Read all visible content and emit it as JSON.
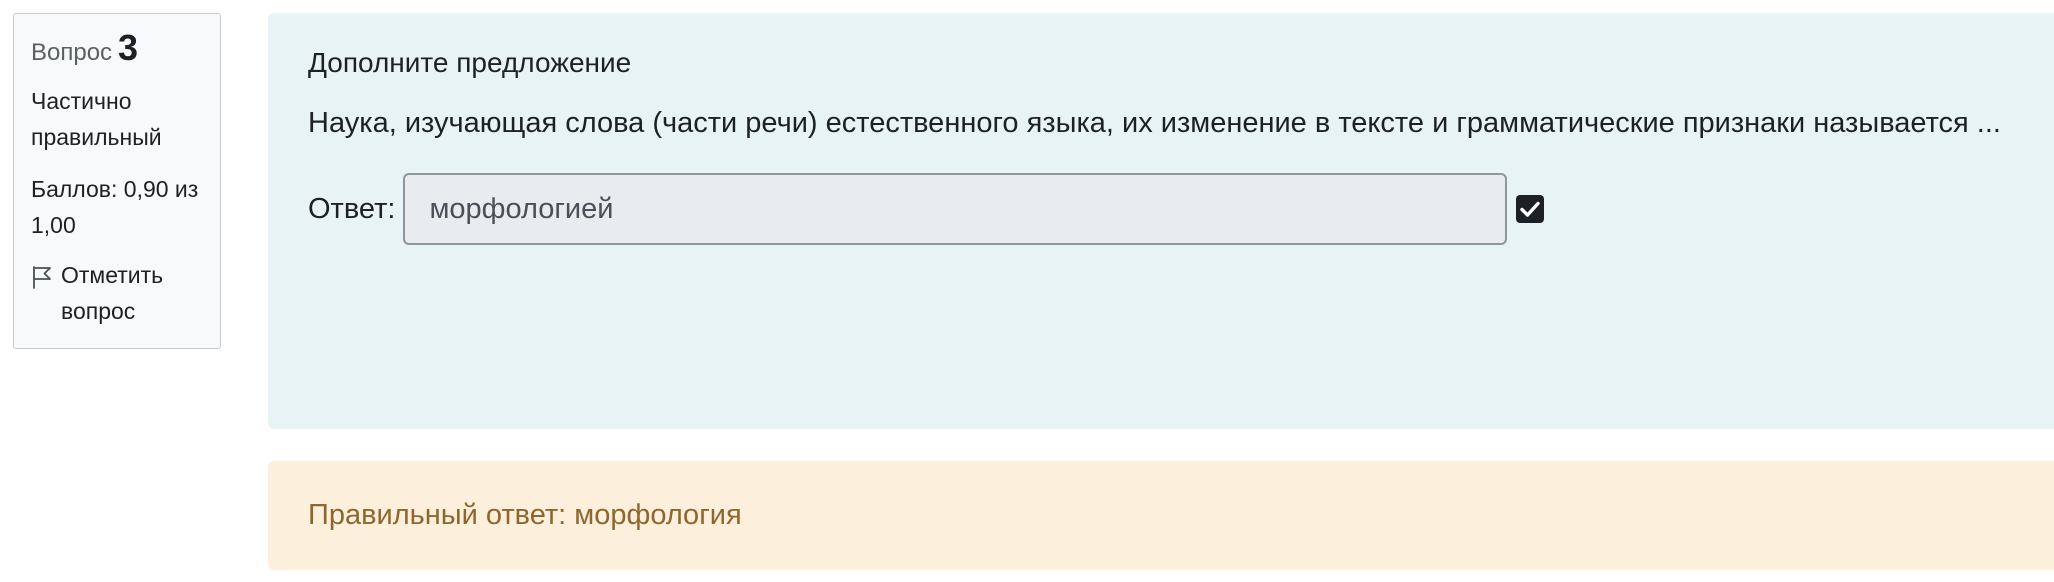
{
  "info": {
    "question_label": "Вопрос",
    "question_number": "3",
    "state": "Частично правильный",
    "grade": "Баллов: 0,90 из 1,00",
    "flag_label": "Отметить вопрос",
    "flag_icon": "flag-icon"
  },
  "question": {
    "title": "Дополните предложение",
    "text": "Наука, изучающая слова (части речи) естественного языка, их изменение в тексте и грамматические признаки называется ...",
    "answer_label": "Ответ:",
    "answer_value": "морфологией",
    "correct_icon": "check-square-icon"
  },
  "feedback": {
    "right_answer": "Правильный ответ: морфология"
  },
  "colors": {
    "info_bg": "#f8f9fa",
    "formulation_bg": "#e7f3f5",
    "feedback_bg": "#fcefdc",
    "feedback_text": "#8e662e",
    "input_bg": "#e9ecef"
  }
}
